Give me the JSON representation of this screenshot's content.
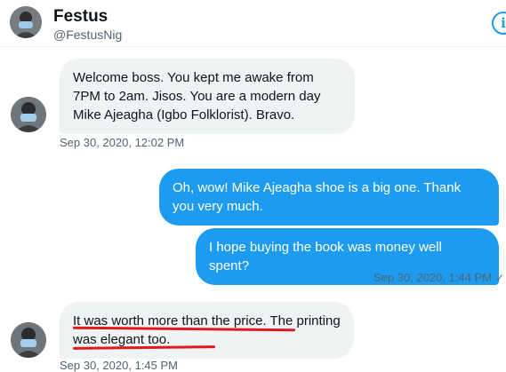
{
  "header": {
    "name": "Festus",
    "handle": "@FestusNig",
    "info_icon": "info-icon"
  },
  "messages": [
    {
      "direction": "incoming",
      "text": "Welcome boss. You kept me awake from 7PM to 2am. Jisos. You are a modern day Mike Ajeagha (Igbo Folklorist). Bravo.",
      "timestamp": "Sep 30, 2020, 12:02 PM"
    },
    {
      "direction": "outgoing",
      "text": "Oh, wow! Mike Ajeagha shoe is a big one. Thank you very much."
    },
    {
      "direction": "outgoing",
      "text": "I hope buying the book was money well spent?",
      "timestamp": "Sep 30, 2020, 1:44 PM",
      "status_icon": "check-icon"
    },
    {
      "direction": "incoming",
      "text": "It was worth more than the price. The printing was elegant too.",
      "timestamp": "Sep 30, 2020, 1:45 PM"
    }
  ],
  "colors": {
    "accent": "#1d9bf0",
    "incoming_bubble": "#eff3f4",
    "annotation": "#e0191f"
  }
}
